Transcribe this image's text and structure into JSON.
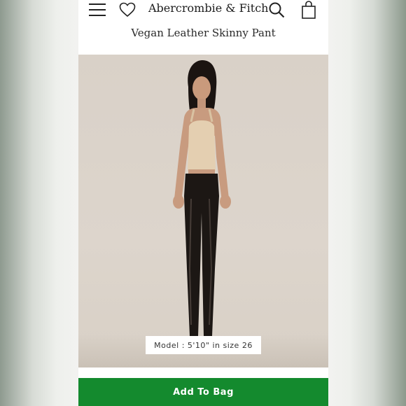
{
  "header": {
    "brand": "Abercrombie & Fitch",
    "icons": [
      "menu-icon",
      "heart-icon",
      "search-icon",
      "bag-icon"
    ]
  },
  "product": {
    "title": "Vegan Leather Skinny Pant",
    "model_caption": "Model : 5'10\" in size 26"
  },
  "actions": {
    "add_to_bag_label": "Add To Bag"
  },
  "colors": {
    "accent_green": "#148a2e",
    "hero_background": "#d9d1c8",
    "text": "#1c1c1c"
  }
}
